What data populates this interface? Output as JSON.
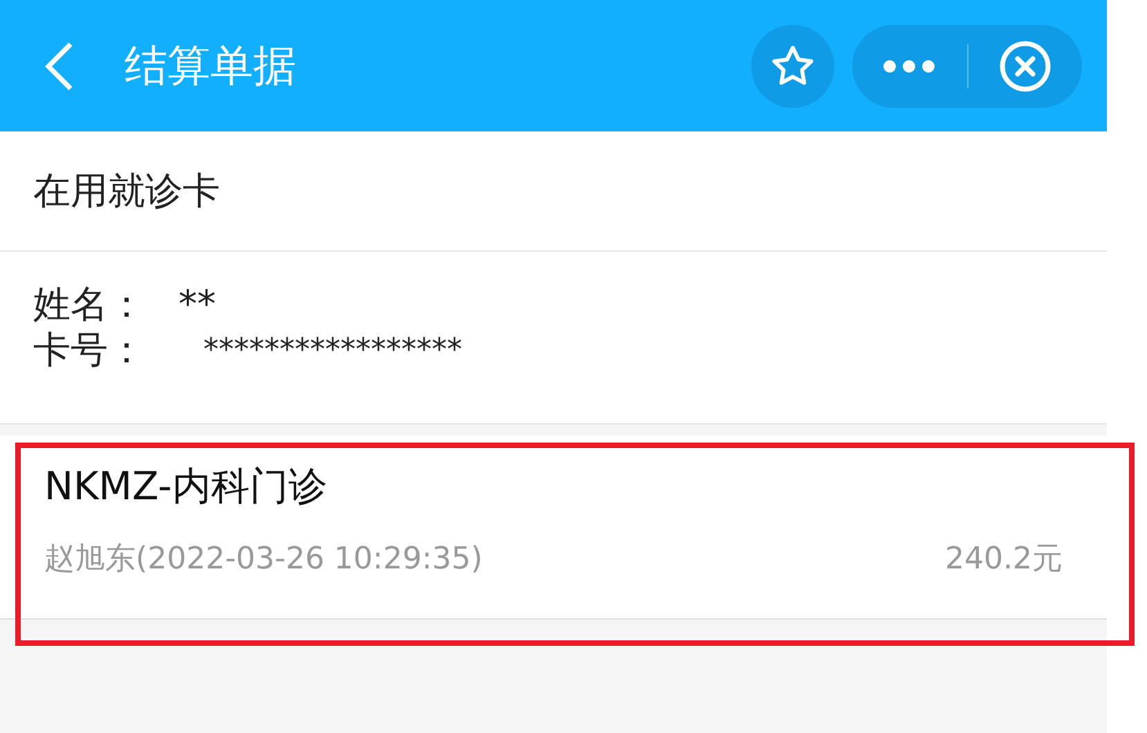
{
  "header": {
    "title": "结算单据"
  },
  "section_title": "在用就诊卡",
  "patient": {
    "fields": [
      {
        "label": "姓名：",
        "value": "**"
      },
      {
        "label": "卡号：",
        "value": "*****************"
      }
    ]
  },
  "records": [
    {
      "title": "NKMZ-内科门诊",
      "detail": "赵旭东(2022-03-26 10:29:35)",
      "amount": "240.2元",
      "highlighted": true
    }
  ]
}
